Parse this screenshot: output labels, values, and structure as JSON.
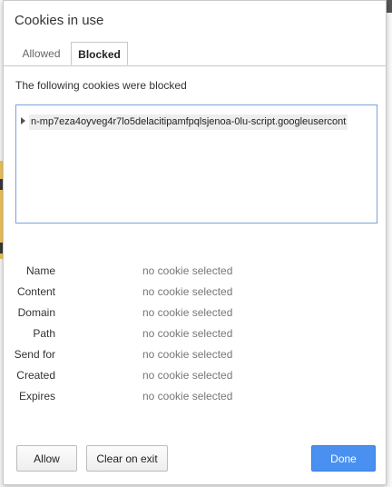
{
  "dialog": {
    "title": "Cookies in use",
    "tabs": [
      {
        "label": "Allowed",
        "active": false
      },
      {
        "label": "Blocked",
        "active": true
      }
    ],
    "subtitle": "The following cookies were blocked",
    "tree": {
      "items": [
        {
          "label": "n-mp7eza4oyveg4r7lo5delacitipamfpqlsjenoa-0lu-script.googleusercont",
          "expanded": false
        }
      ]
    },
    "details": [
      {
        "label": "Name",
        "value": "no cookie selected"
      },
      {
        "label": "Content",
        "value": "no cookie selected"
      },
      {
        "label": "Domain",
        "value": "no cookie selected"
      },
      {
        "label": "Path",
        "value": "no cookie selected"
      },
      {
        "label": "Send for",
        "value": "no cookie selected"
      },
      {
        "label": "Created",
        "value": "no cookie selected"
      },
      {
        "label": "Expires",
        "value": "no cookie selected"
      }
    ],
    "buttons": {
      "allow": "Allow",
      "clear": "Clear on exit",
      "done": "Done"
    }
  },
  "colors": {
    "accent": "#4a90f0",
    "tree_border": "#7aa3d9"
  }
}
